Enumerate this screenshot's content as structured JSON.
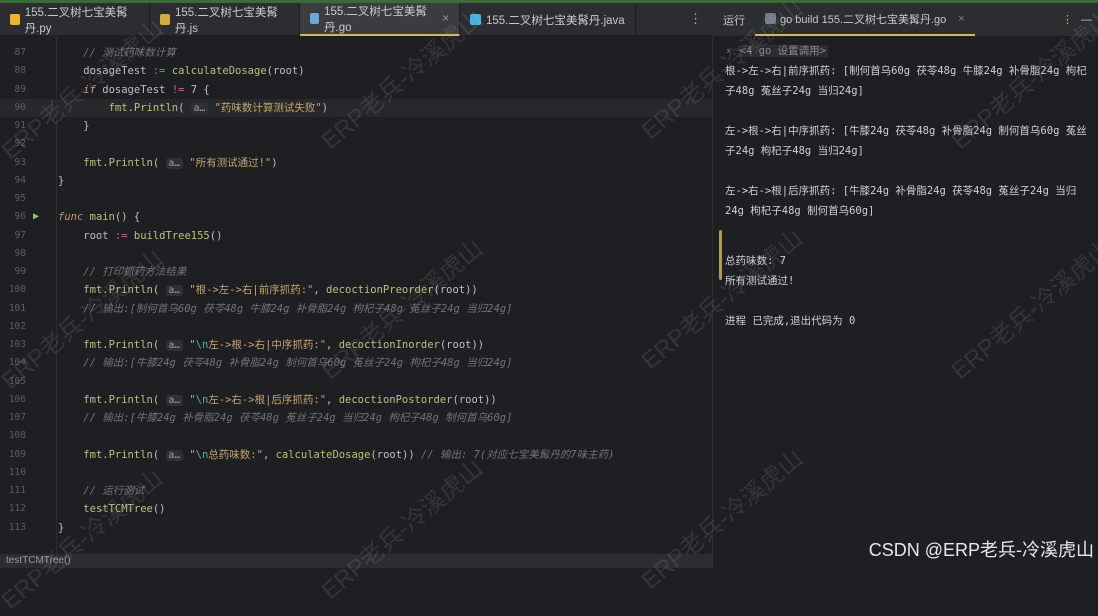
{
  "tabs": [
    {
      "label": "155.二叉树七宝美髯丹.py",
      "icon": "python-icon",
      "color": "#f0b429"
    },
    {
      "label": "155.二叉树七宝美髯丹.js",
      "icon": "js-icon",
      "color": "#d9a93a"
    },
    {
      "label": "155.二叉树七宝美髯丹.go",
      "icon": "go-icon",
      "color": "#6ea8d8",
      "active": true,
      "close": "×"
    },
    {
      "label": "155.二叉树七宝美髯丹.java",
      "icon": "java-icon",
      "color": "#3fb6e0"
    }
  ],
  "more": "⋮",
  "lines": [
    {
      "n": "87",
      "html": "    <span class='cm'>// 测试药味数计算</span>"
    },
    {
      "n": "88",
      "html": "    dosageTest <span class='op'>:=</span> <span class='fn'>calculateDosage</span>(root)"
    },
    {
      "n": "89",
      "html": "    <span class='kw'>if</span> dosageTest <span class='op'>!=</span> 7 {"
    },
    {
      "n": "90",
      "html": "        <span class='pkg'>fmt</span>.<span class='fn'>Println</span>( <span class='hint'>a…</span> <span class='str'>\"药味数计算测试失败\"</span>)",
      "cur": true
    },
    {
      "n": "91",
      "html": "    }"
    },
    {
      "n": "92",
      "html": ""
    },
    {
      "n": "93",
      "html": "    <span class='pkg'>fmt</span>.<span class='fn'>Println</span>( <span class='hint'>a…</span> <span class='str'>\"所有测试通过!\"</span>)"
    },
    {
      "n": "94",
      "html": "}"
    },
    {
      "n": "95",
      "html": ""
    },
    {
      "n": "96",
      "html": "<span class='kw'>func</span> <span class='fn'>main</span>() {",
      "run": true
    },
    {
      "n": "97",
      "html": "    root <span class='op'>:=</span> <span class='fn'>buildTree155</span>()"
    },
    {
      "n": "98",
      "html": ""
    },
    {
      "n": "99",
      "html": "    <span class='cm'>// 打印抓药方法结果</span>"
    },
    {
      "n": "100",
      "html": "    <span class='pkg'>fmt</span>.<span class='fn'>Println</span>( <span class='hint'>a…</span> <span class='str'>\"根->左->右|前序抓药:\"</span>, <span class='fn'>decoctionPreorder</span>(root))"
    },
    {
      "n": "101",
      "html": "    <span class='cm'>// 输出:[制何首乌60g 茯苓48g 牛膝24g 补骨脂24g 枸杞子48g 菟丝子24g 当归24g]</span>"
    },
    {
      "n": "102",
      "html": ""
    },
    {
      "n": "103",
      "html": "    <span class='pkg'>fmt</span>.<span class='fn'>Println</span>( <span class='hint'>a…</span> <span class='str'>\"<span class='esc'>\\n</span>左->根->右|中序抓药:\"</span>, <span class='fn'>decoctionInorder</span>(root))"
    },
    {
      "n": "104",
      "html": "    <span class='cm'>// 输出:[牛膝24g 茯苓48g 补骨脂24g 制何首乌60g 菟丝子24g 枸杞子48g 当归24g]</span>"
    },
    {
      "n": "105",
      "html": ""
    },
    {
      "n": "106",
      "html": "    <span class='pkg'>fmt</span>.<span class='fn'>Println</span>( <span class='hint'>a…</span> <span class='str'>\"<span class='esc'>\\n</span>左->右->根|后序抓药:\"</span>, <span class='fn'>decoctionPostorder</span>(root))"
    },
    {
      "n": "107",
      "html": "    <span class='cm'>// 输出:[牛膝24g 补骨脂24g 茯苓48g 菟丝子24g 当归24g 枸杞子48g 制何首乌60g]</span>"
    },
    {
      "n": "108",
      "html": ""
    },
    {
      "n": "109",
      "html": "    <span class='pkg'>fmt</span>.<span class='fn'>Println</span>( <span class='hint'>a…</span> <span class='str'>\"<span class='esc'>\\n</span>总药味数:\"</span>, <span class='fn'>calculateDosage</span>(root)) <span class='cm'>// 输出: 7(对应七宝美髯丹的7味主药)</span>"
    },
    {
      "n": "110",
      "html": ""
    },
    {
      "n": "111",
      "html": "    <span class='cm'>// 运行测试</span>"
    },
    {
      "n": "112",
      "html": "    <span class='fn'>testTCMTree</span>()"
    },
    {
      "n": "113",
      "html": "}"
    }
  ],
  "status": {
    "breadcrumb": "testTCMTree()"
  },
  "run_panel": {
    "tab_run": "运行",
    "tab_build": "go build 155.二叉树七宝美髯丹.go",
    "close": "×",
    "cmd": "<4 go 设置调用>",
    "output": [
      "根->左->右|前序抓药: [制何首乌60g 茯苓48g 牛膝24g 补骨脂24g 枸杞子48g 菟丝子24g 当归24g]",
      "",
      "左->根->右|中序抓药: [牛膝24g 茯苓48g 补骨脂24g 制何首乌60g 菟丝子24g 枸杞子48g 当归24g]",
      "",
      "左->右->根|后序抓药: [牛膝24g 补骨脂24g 茯苓48g 菟丝子24g 当归24g 枸杞子48g 制何首乌60g]",
      "",
      "总药味数: 7",
      "所有测试通过!",
      "",
      "进程 已完成,退出代码为 0"
    ]
  },
  "watermark": "ERP老兵-冷溪虎山",
  "credit": "CSDN @ERP老兵-冷溪虎山"
}
